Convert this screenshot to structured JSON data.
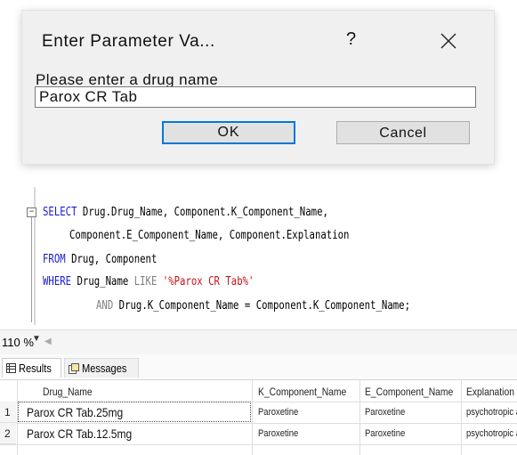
{
  "dialog": {
    "title": "Enter Parameter Va...",
    "help_label": "?",
    "prompt": "Please enter a drug name",
    "input_value": "Parox CR Tab",
    "ok_label": "OK",
    "cancel_label": "Cancel"
  },
  "editor": {
    "line1_kw": "SELECT",
    "line1_rest": " Drug.Drug_Name, Component.K_Component_Name,",
    "line2": "Component.E_Component_Name, Component.Explanation",
    "line3_kw": "FROM",
    "line3_rest": " Drug, Component",
    "line4_kw": "WHERE",
    "line4_col": " Drug_Name ",
    "line4_like": "LIKE",
    "line4_str": " '%Parox CR Tab%'",
    "line5_and": "AND",
    "line5_rest": " Drug.K_Component_Name = Component.K_Component_Name;"
  },
  "zoom": {
    "level": "110 %"
  },
  "results": {
    "tab_results": "Results",
    "tab_messages": "Messages",
    "columns": [
      "Drug_Name",
      "K_Component_Name",
      "E_Component_Name",
      "Explanation"
    ],
    "rows": [
      {
        "num": "1",
        "drug_name": "Parox CR Tab.25mg",
        "k_component": "Paroxetine",
        "e_component": "Paroxetine",
        "explanation": "psychotropic a"
      },
      {
        "num": "2",
        "drug_name": "Parox CR Tab.12.5mg",
        "k_component": "Paroxetine",
        "e_component": "Paroxetine",
        "explanation": "psychotropic a"
      }
    ]
  },
  "colors": {
    "keyword": "#1a1ad8",
    "string": "#c4141b",
    "focus_border": "#0078d7"
  }
}
